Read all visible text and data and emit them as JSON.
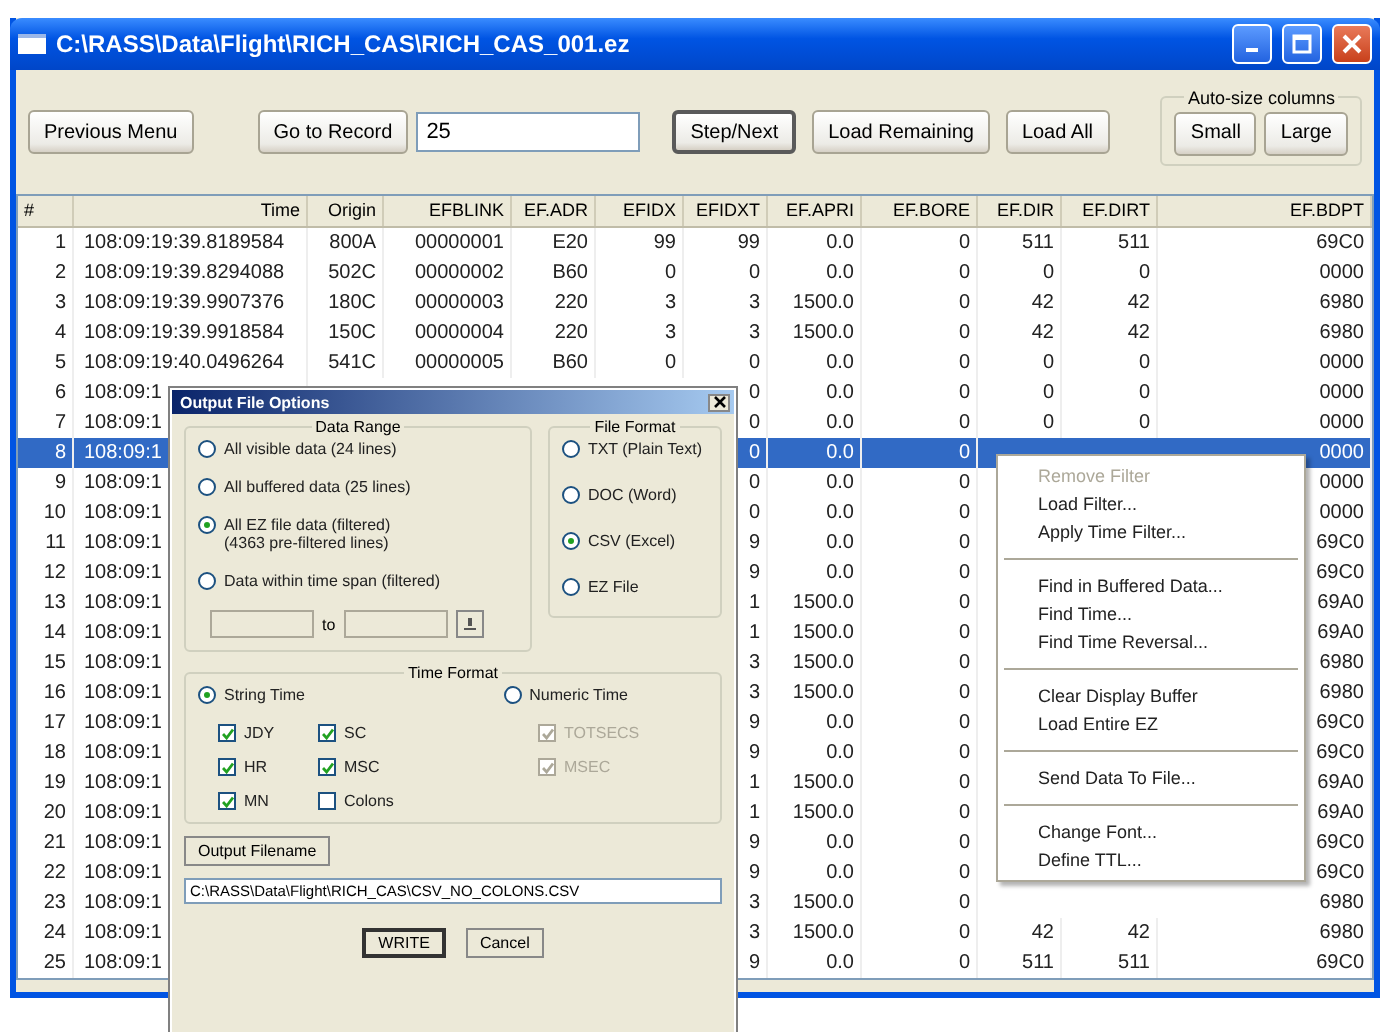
{
  "window": {
    "title": "C:\\RASS\\Data\\Flight\\RICH_CAS\\RICH_CAS_001.ez"
  },
  "toolbar": [
    {
      "kind": "button",
      "label": "Previous Menu",
      "default": false
    },
    {
      "kind": "button",
      "label": "Go to Record",
      "default": false
    },
    {
      "kind": "field",
      "value": "25"
    },
    {
      "kind": "button",
      "label": "Step/Next",
      "default": true
    },
    {
      "kind": "button",
      "label": "Load Remaining",
      "default": false
    },
    {
      "kind": "button",
      "label": "Load All",
      "default": false
    }
  ],
  "autosize": {
    "label": "Auto-size columns",
    "buttons": [
      "Small",
      "Large"
    ]
  },
  "table": {
    "columns": [
      "#",
      "Time",
      "Origin",
      "EFBLINK",
      "EF.ADR",
      "EFIDX",
      "EFIDXT",
      "EF.APRI",
      "EF.BORE",
      "EF.DIR",
      "EF.DIRT",
      "EF.BDPT"
    ],
    "rows": [
      {
        "selected": false,
        "cells": [
          "1",
          "108:09:19:39.8189584",
          "800A",
          "00000001",
          "E20",
          "99",
          "99",
          "0.0",
          "0",
          "511",
          "511",
          "69C0"
        ]
      },
      {
        "selected": false,
        "cells": [
          "2",
          "108:09:19:39.8294088",
          "502C",
          "00000002",
          "B60",
          "0",
          "0",
          "0.0",
          "0",
          "0",
          "0",
          "0000"
        ]
      },
      {
        "selected": false,
        "cells": [
          "3",
          "108:09:19:39.9907376",
          "180C",
          "00000003",
          "220",
          "3",
          "3",
          "1500.0",
          "0",
          "42",
          "42",
          "6980"
        ]
      },
      {
        "selected": false,
        "cells": [
          "4",
          "108:09:19:39.9918584",
          "150C",
          "00000004",
          "220",
          "3",
          "3",
          "1500.0",
          "0",
          "42",
          "42",
          "6980"
        ]
      },
      {
        "selected": false,
        "cells": [
          "5",
          "108:09:19:40.0496264",
          "541C",
          "00000005",
          "B60",
          "0",
          "0",
          "0.0",
          "0",
          "0",
          "0",
          "0000"
        ]
      },
      {
        "selected": false,
        "cells": [
          "6",
          "108:09:1",
          null,
          null,
          null,
          null,
          "0",
          "0.0",
          "0",
          "0",
          "0",
          "0000"
        ]
      },
      {
        "selected": false,
        "cells": [
          "7",
          "108:09:1",
          null,
          null,
          null,
          null,
          "0",
          "0.0",
          "0",
          "0",
          "0",
          "0000"
        ]
      },
      {
        "selected": true,
        "cells": [
          "8",
          "108:09:1",
          null,
          null,
          null,
          null,
          "0",
          "0.0",
          "0",
          null,
          null,
          "0000"
        ]
      },
      {
        "selected": false,
        "cells": [
          "9",
          "108:09:1",
          null,
          null,
          null,
          null,
          "0",
          "0.0",
          "0",
          null,
          null,
          "0000"
        ]
      },
      {
        "selected": false,
        "cells": [
          "10",
          "108:09:1",
          null,
          null,
          null,
          null,
          "0",
          "0.0",
          "0",
          null,
          null,
          "0000"
        ]
      },
      {
        "selected": false,
        "cells": [
          "11",
          "108:09:1",
          null,
          null,
          null,
          null,
          "9",
          "0.0",
          "0",
          null,
          null,
          "69C0"
        ]
      },
      {
        "selected": false,
        "cells": [
          "12",
          "108:09:1",
          null,
          null,
          null,
          null,
          "9",
          "0.0",
          "0",
          null,
          null,
          "69C0"
        ]
      },
      {
        "selected": false,
        "cells": [
          "13",
          "108:09:1",
          null,
          null,
          null,
          null,
          "1",
          "1500.0",
          "0",
          null,
          null,
          "69A0"
        ]
      },
      {
        "selected": false,
        "cells": [
          "14",
          "108:09:1",
          null,
          null,
          null,
          null,
          "1",
          "1500.0",
          "0",
          null,
          null,
          "69A0"
        ]
      },
      {
        "selected": false,
        "cells": [
          "15",
          "108:09:1",
          null,
          null,
          null,
          null,
          "3",
          "1500.0",
          "0",
          null,
          null,
          "6980"
        ]
      },
      {
        "selected": false,
        "cells": [
          "16",
          "108:09:1",
          null,
          null,
          null,
          null,
          "3",
          "1500.0",
          "0",
          null,
          null,
          "6980"
        ]
      },
      {
        "selected": false,
        "cells": [
          "17",
          "108:09:1",
          null,
          null,
          null,
          null,
          "9",
          "0.0",
          "0",
          null,
          null,
          "69C0"
        ]
      },
      {
        "selected": false,
        "cells": [
          "18",
          "108:09:1",
          null,
          null,
          null,
          null,
          "9",
          "0.0",
          "0",
          null,
          null,
          "69C0"
        ]
      },
      {
        "selected": false,
        "cells": [
          "19",
          "108:09:1",
          null,
          null,
          null,
          null,
          "1",
          "1500.0",
          "0",
          null,
          null,
          "69A0"
        ]
      },
      {
        "selected": false,
        "cells": [
          "20",
          "108:09:1",
          null,
          null,
          null,
          null,
          "1",
          "1500.0",
          "0",
          null,
          null,
          "69A0"
        ]
      },
      {
        "selected": false,
        "cells": [
          "21",
          "108:09:1",
          null,
          null,
          null,
          null,
          "9",
          "0.0",
          "0",
          null,
          null,
          "69C0"
        ]
      },
      {
        "selected": false,
        "cells": [
          "22",
          "108:09:1",
          null,
          null,
          null,
          null,
          "9",
          "0.0",
          "0",
          null,
          null,
          "69C0"
        ]
      },
      {
        "selected": false,
        "cells": [
          "23",
          "108:09:1",
          null,
          null,
          null,
          null,
          "3",
          "1500.0",
          "0",
          null,
          null,
          "6980"
        ]
      },
      {
        "selected": false,
        "cells": [
          "24",
          "108:09:1",
          null,
          null,
          null,
          null,
          "3",
          "1500.0",
          "0",
          "42",
          "42",
          "6980"
        ]
      },
      {
        "selected": false,
        "cells": [
          "25",
          "108:09:1",
          null,
          null,
          null,
          null,
          "9",
          "0.0",
          "0",
          "511",
          "511",
          "69C0"
        ]
      }
    ]
  },
  "dialog": {
    "title": "Output File Options",
    "data_range": {
      "label": "Data Range",
      "options": [
        {
          "label": "All visible data (24 lines)",
          "selected": false
        },
        {
          "label": "All buffered data (25 lines)",
          "selected": false
        },
        {
          "label": "All EZ file data (filtered)",
          "note": "(4363 pre-filtered lines)",
          "selected": true
        },
        {
          "label": "Data within time span (filtered)",
          "selected": false
        }
      ],
      "to": "to"
    },
    "file_format": {
      "label": "File Format",
      "options": [
        {
          "label": "TXT (Plain Text)",
          "selected": false
        },
        {
          "label": "DOC (Word)",
          "selected": false
        },
        {
          "label": "CSV (Excel)",
          "selected": true
        },
        {
          "label": "EZ File",
          "selected": false
        }
      ]
    },
    "time_format": {
      "label": "Time Format",
      "options": [
        {
          "label": "String Time",
          "selected": true
        },
        {
          "label": "Numeric Time",
          "selected": false
        }
      ],
      "checkboxes": [
        {
          "label": "JDY",
          "checked": true,
          "disabled": false
        },
        {
          "label": "SC",
          "checked": true,
          "disabled": false
        },
        {
          "label": "TOTSECS",
          "checked": true,
          "disabled": true
        },
        {
          "label": "HR",
          "checked": true,
          "disabled": false
        },
        {
          "label": "MSC",
          "checked": true,
          "disabled": false
        },
        {
          "label": "MSEC",
          "checked": true,
          "disabled": true
        },
        {
          "label": "MN",
          "checked": true,
          "disabled": false
        },
        {
          "label": "Colons",
          "checked": false,
          "disabled": false
        }
      ]
    },
    "output_button": "Output Filename",
    "filename": {
      "value": "C:\\RASS\\Data\\Flight\\RICH_CAS\\CSV_NO_COLONS.CSV"
    },
    "buttons": [
      {
        "label": "WRITE",
        "default": true
      },
      {
        "label": "Cancel",
        "default": false
      }
    ]
  },
  "context_menu": {
    "items": [
      {
        "kind": "item",
        "label": "Remove Filter",
        "disabled": true
      },
      {
        "kind": "item",
        "label": "Load Filter...",
        "disabled": false
      },
      {
        "kind": "item",
        "label": "Apply Time Filter...",
        "disabled": false
      },
      {
        "kind": "separator"
      },
      {
        "kind": "item",
        "label": "Find in Buffered Data...",
        "disabled": false
      },
      {
        "kind": "item",
        "label": "Find Time...",
        "disabled": false
      },
      {
        "kind": "item",
        "label": "Find Time Reversal...",
        "disabled": false
      },
      {
        "kind": "separator"
      },
      {
        "kind": "item",
        "label": "Clear Display Buffer",
        "disabled": false
      },
      {
        "kind": "item",
        "label": "Load Entire EZ",
        "disabled": false
      },
      {
        "kind": "separator"
      },
      {
        "kind": "item",
        "label": "Send Data To File...",
        "disabled": false
      },
      {
        "kind": "separator"
      },
      {
        "kind": "item",
        "label": "Change Font...",
        "disabled": false
      },
      {
        "kind": "item",
        "label": "Define TTL...",
        "disabled": false
      }
    ]
  }
}
